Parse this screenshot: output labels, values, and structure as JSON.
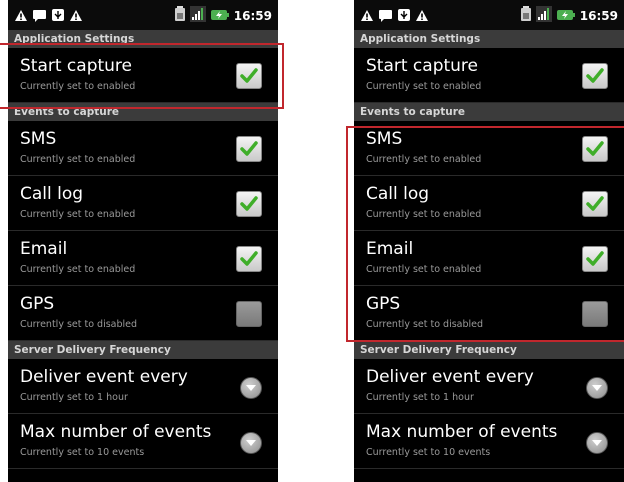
{
  "status_bar": {
    "time": "16:59"
  },
  "sections": {
    "application": "Application Settings",
    "events": "Events to capture",
    "server": "Server Delivery Frequency"
  },
  "items": {
    "start_capture": {
      "title": "Start capture",
      "subtitle": "Currently set to enabled",
      "checked": true
    },
    "sms": {
      "title": "SMS",
      "subtitle": "Currently set to enabled",
      "checked": true
    },
    "call_log": {
      "title": "Call log",
      "subtitle": "Currently set to enabled",
      "checked": true
    },
    "email": {
      "title": "Email",
      "subtitle": "Currently set to enabled",
      "checked": true
    },
    "gps": {
      "title": "GPS",
      "subtitle": "Currently set to disabled",
      "checked": false
    },
    "deliver_event": {
      "title": "Deliver event every",
      "subtitle": "Currently set to 1 hour"
    },
    "max_events": {
      "title": "Max number of events",
      "subtitle": "Currently set to 10 events"
    }
  },
  "colors": {
    "highlight": "#c1272d",
    "check": "#3fae29",
    "section_bg": "#3b3b3b"
  },
  "icons": [
    "warning-icon",
    "message-icon",
    "usb-icon",
    "battery-icon",
    "signal-icon",
    "charging-icon",
    "check-icon",
    "dropdown-icon"
  ]
}
